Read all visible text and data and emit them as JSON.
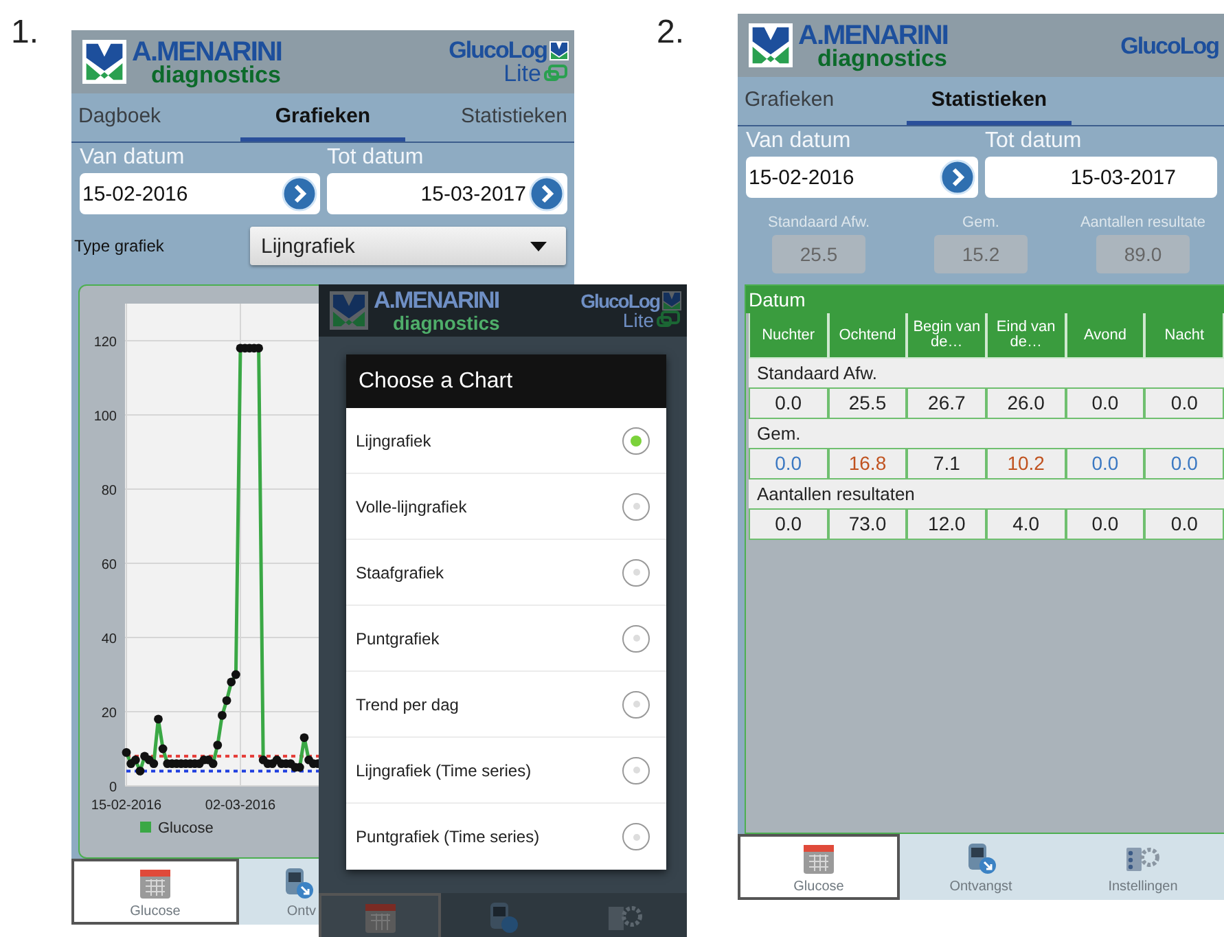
{
  "labels": [
    "1.",
    "2."
  ],
  "screen_1": {
    "header": {
      "brand": "A.MENARINI",
      "brand_sub": "diagnostics",
      "app": "GlucoLog",
      "app_sub": "Lite"
    },
    "tabs": [
      {
        "label": "Dagboek",
        "selected": false
      },
      {
        "label": "Grafieken",
        "selected": true
      },
      {
        "label": "Statistieken",
        "selected": false
      }
    ],
    "from_label": "Van datum",
    "from_date": "15-02-2016",
    "to_label": "Tot datum",
    "to_date": "15-03-2017",
    "chart_type_label": "Type grafiek",
    "chart_type_value": "Lijngrafiek",
    "chart_data": {
      "type": "line",
      "categories": [
        "15-02-2016",
        null,
        null,
        null,
        null,
        null,
        null,
        null,
        null,
        null,
        null,
        null,
        null,
        null,
        null,
        null,
        null,
        null,
        null,
        null,
        null,
        null,
        null,
        null,
        null,
        "02-03-2016",
        null,
        null,
        null,
        null,
        null,
        null,
        null,
        null,
        null,
        null,
        null,
        null,
        null,
        null,
        null,
        null,
        null,
        null
      ],
      "series": [
        {
          "name": "Glucose",
          "color": "#3aa845",
          "marker": "o",
          "values": [
            9,
            6,
            7,
            4,
            8,
            7,
            6,
            18,
            10,
            6,
            6,
            6,
            6,
            6,
            6,
            6,
            6,
            7,
            7,
            6,
            11,
            19,
            23,
            28,
            30,
            118,
            118,
            118,
            118,
            118,
            7,
            6,
            6,
            7,
            6,
            6,
            6,
            5,
            5,
            13,
            7,
            6,
            6,
            null
          ]
        }
      ],
      "grid": true,
      "ylim": [
        0,
        130
      ],
      "yticks": [
        0,
        20,
        40,
        60,
        80,
        100,
        120
      ],
      "ref_lines": [
        {
          "axis": "y",
          "value": 8,
          "color": "#e53935"
        },
        {
          "axis": "y",
          "value": 4,
          "color": "#1f3fe0"
        }
      ]
    },
    "nav": [
      {
        "label": "Glucose",
        "selected": true
      },
      {
        "label": "Ontv",
        "selected": false
      }
    ]
  },
  "chart_dialog": {
    "header": {
      "brand": "A.MENARINI",
      "brand_sub": "diagnostics",
      "app": "GlucoLog",
      "app_sub": "Lite"
    },
    "title": "Choose a Chart",
    "options": [
      {
        "label": "Lijngrafiek",
        "selected": true
      },
      {
        "label": "Volle-lijngrafiek",
        "selected": false
      },
      {
        "label": "Staafgrafiek",
        "selected": false
      },
      {
        "label": "Puntgrafiek",
        "selected": false
      },
      {
        "label": "Trend per dag",
        "selected": false
      },
      {
        "label": "Lijngrafiek (Time series)",
        "selected": false
      },
      {
        "label": "Puntgrafiek (Time series)",
        "selected": false
      }
    ],
    "nav": [
      {
        "selected": true
      },
      {
        "selected": false
      },
      {
        "selected": false
      }
    ]
  },
  "screen_2": {
    "header": {
      "brand": "A.MENARINI",
      "brand_sub": "diagnostics",
      "app": "GlucoLog"
    },
    "tabs": [
      {
        "label": "Grafieken",
        "selected": false
      },
      {
        "label": "Statistieken",
        "selected": true
      }
    ],
    "from_label": "Van datum",
    "from_date": "15-02-2016",
    "to_label": "Tot datum",
    "to_date": "15-03-2017",
    "stats": [
      {
        "label": "Standaard Afw.",
        "value": "25.5"
      },
      {
        "label": "Gem.",
        "value": "15.2"
      },
      {
        "label": "Aantallen resultate",
        "value": "89.0"
      }
    ],
    "table": {
      "title": "Datum",
      "columns": [
        "Nuchter",
        "Ochtend",
        "Begin van de…",
        "Eind van de…",
        "Avond",
        "Nacht"
      ],
      "groups": [
        {
          "label": "Standaard Afw.",
          "cells": [
            {
              "text": "0.0",
              "color": "#222222"
            },
            {
              "text": "25.5",
              "color": "#222222"
            },
            {
              "text": "26.7",
              "color": "#222222"
            },
            {
              "text": "26.0",
              "color": "#222222"
            },
            {
              "text": "0.0",
              "color": "#222222"
            },
            {
              "text": "0.0",
              "color": "#222222"
            }
          ]
        },
        {
          "label": "Gem.",
          "cells": [
            {
              "text": "0.0",
              "color": "#3b78c2"
            },
            {
              "text": "16.8",
              "color": "#c0521f"
            },
            {
              "text": "7.1",
              "color": "#222222"
            },
            {
              "text": "10.2",
              "color": "#c0521f"
            },
            {
              "text": "0.0",
              "color": "#3b78c2"
            },
            {
              "text": "0.0",
              "color": "#3b78c2"
            }
          ]
        },
        {
          "label": "Aantallen resultaten",
          "cells": [
            {
              "text": "0.0",
              "color": "#222222"
            },
            {
              "text": "73.0",
              "color": "#222222"
            },
            {
              "text": "12.0",
              "color": "#222222"
            },
            {
              "text": "4.0",
              "color": "#222222"
            },
            {
              "text": "0.0",
              "color": "#222222"
            },
            {
              "text": "0.0",
              "color": "#222222"
            }
          ]
        }
      ]
    },
    "nav": [
      {
        "label": "Glucose",
        "selected": true
      },
      {
        "label": "Ontvangst",
        "selected": false
      },
      {
        "label": "Instellingen",
        "selected": false
      }
    ]
  }
}
